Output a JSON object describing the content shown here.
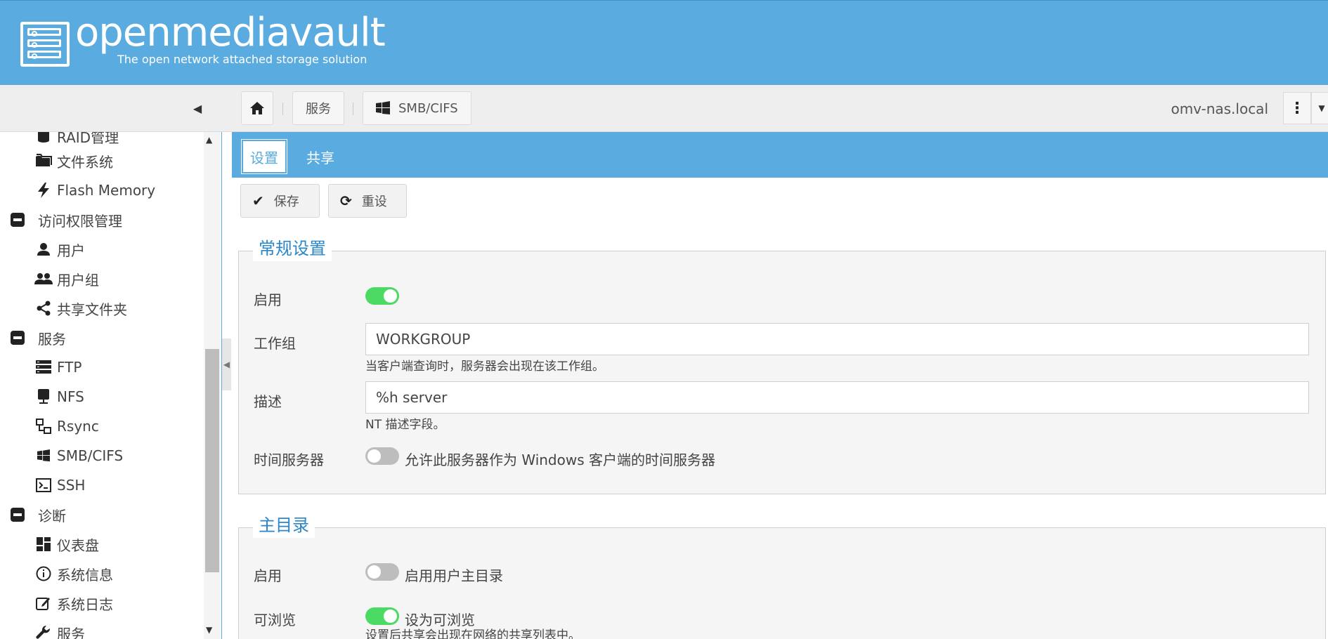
{
  "header": {
    "title": "openmediavault",
    "subtitle": "The open network attached storage solution"
  },
  "toolbar": {
    "crumbs": [
      "服务",
      "SMB/CIFS"
    ],
    "hostname": "omv-nas.local"
  },
  "sidebar": {
    "items": [
      {
        "label": "RAID管理",
        "icon": "database-icon"
      },
      {
        "label": "文件系统",
        "icon": "folder-icon"
      },
      {
        "label": "Flash Memory",
        "icon": "flash-icon"
      },
      {
        "label": "访问权限管理",
        "icon": "collapse-icon"
      },
      {
        "label": "用户",
        "icon": "user-icon"
      },
      {
        "label": "用户组",
        "icon": "group-icon"
      },
      {
        "label": "共享文件夹",
        "icon": "share-icon"
      },
      {
        "label": "服务",
        "icon": "collapse-icon"
      },
      {
        "label": "FTP",
        "icon": "server-icon"
      },
      {
        "label": "NFS",
        "icon": "desktop-icon"
      },
      {
        "label": "Rsync",
        "icon": "network-icon"
      },
      {
        "label": "SMB/CIFS",
        "icon": "windows-icon"
      },
      {
        "label": "SSH",
        "icon": "terminal-icon"
      },
      {
        "label": "诊断",
        "icon": "collapse-icon"
      },
      {
        "label": "仪表盘",
        "icon": "dashboard-icon"
      },
      {
        "label": "系统信息",
        "icon": "info-icon"
      },
      {
        "label": "系统日志",
        "icon": "edit-icon"
      },
      {
        "label": "服务",
        "icon": "wrench-icon"
      }
    ]
  },
  "tabs": [
    "设置",
    "共享"
  ],
  "actions": {
    "save": "保存",
    "reset": "重设"
  },
  "general": {
    "legend": "常规设置",
    "enable_label": "启用",
    "enabled": true,
    "workgroup_label": "工作组",
    "workgroup_value": "WORKGROUP",
    "workgroup_hint": "当客户端查询时，服务器会出现在该工作组。",
    "desc_label": "描述",
    "desc_value": "%h server",
    "desc_hint": "NT 描述字段。",
    "timeserver_label": "时间服务器",
    "timeserver_enabled": false,
    "timeserver_text": "允许此服务器作为 Windows 客户端的时间服务器"
  },
  "homes": {
    "legend": "主目录",
    "enable_label": "启用",
    "enabled": false,
    "enable_text": "启用用户主目录",
    "browse_label": "可浏览",
    "browse_enabled": true,
    "browse_text": "设为可浏览",
    "browse_hint": "设置后共享会出现在网络的共享列表中。"
  }
}
